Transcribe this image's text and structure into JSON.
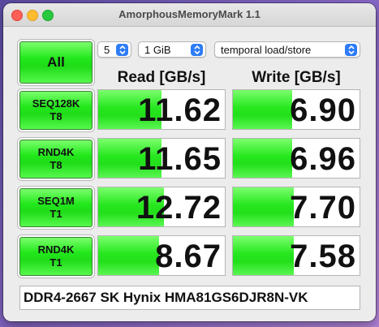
{
  "window": {
    "title": "AmorphousMemoryMark 1.1"
  },
  "controls": {
    "all_label": "All",
    "count_value": "5",
    "size_value": "1 GiB",
    "mode_value": "temporal load/store"
  },
  "headers": {
    "read": "Read [GB/s]",
    "write": "Write [GB/s]"
  },
  "tests": [
    {
      "line1": "SEQ128K",
      "line2": "T8",
      "read": "11.62",
      "write": "6.90",
      "read_fill": 0.5,
      "write_fill": 0.47
    },
    {
      "line1": "RND4K",
      "line2": "T8",
      "read": "11.65",
      "write": "6.96",
      "read_fill": 0.5,
      "write_fill": 0.47
    },
    {
      "line1": "SEQ1M",
      "line2": "T1",
      "read": "12.72",
      "write": "7.70",
      "read_fill": 0.52,
      "write_fill": 0.48
    },
    {
      "line1": "RND4K",
      "line2": "T1",
      "read": "8.67",
      "write": "7.58",
      "read_fill": 0.48,
      "write_fill": 0.48
    }
  ],
  "memory_model": "DDR4-2667 SK Hynix HMA81GS6DJR8N-VK",
  "colors": {
    "accent_green": "#22e81b",
    "select_blue": "#2d7cf6"
  }
}
